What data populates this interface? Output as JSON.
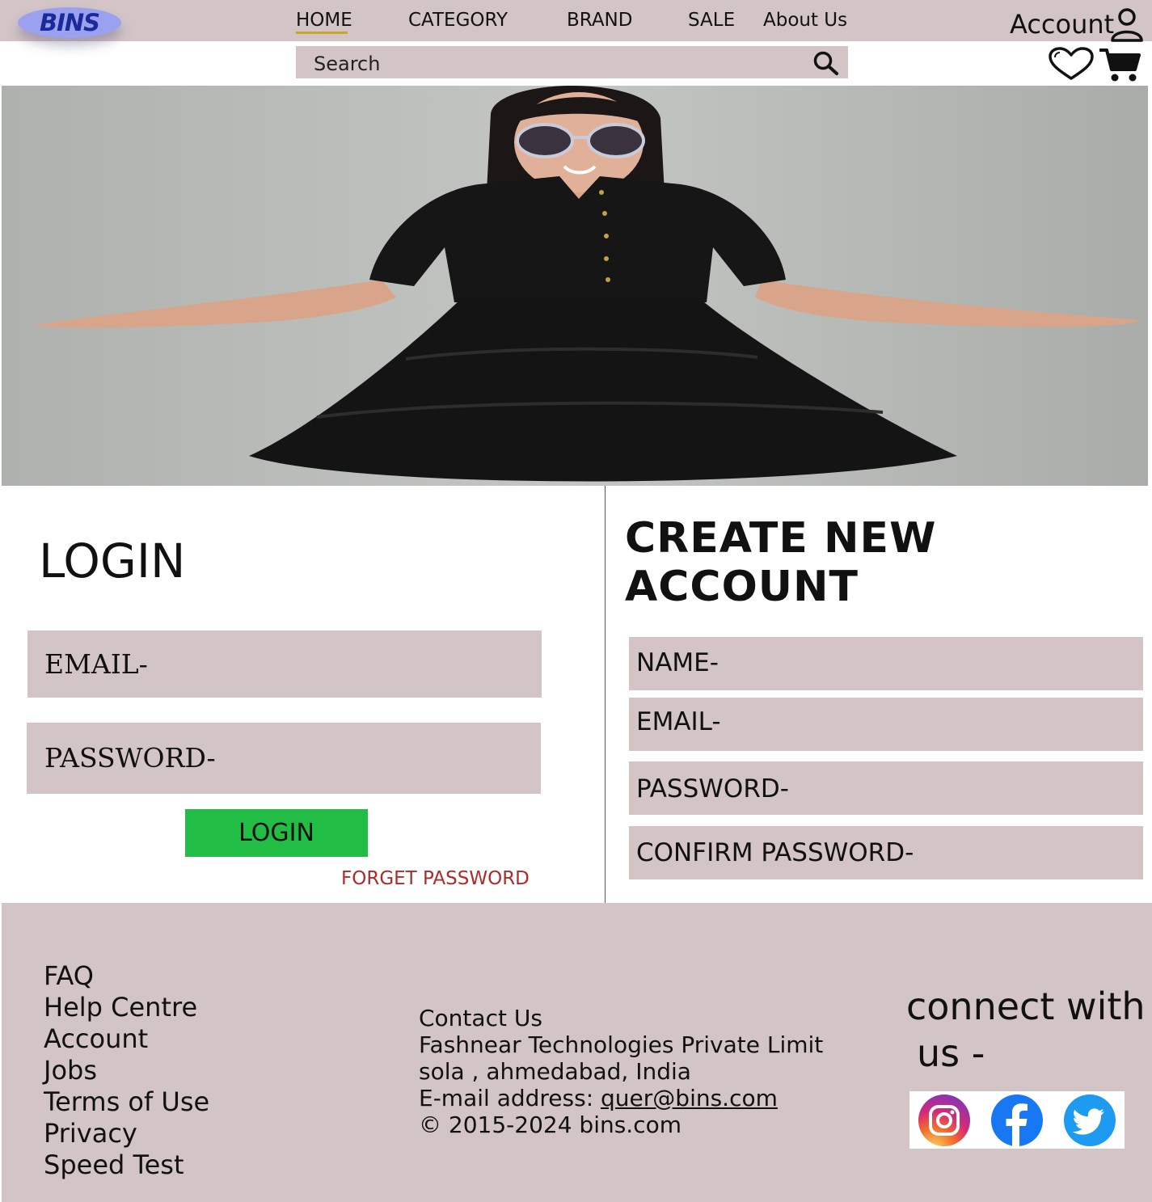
{
  "header": {
    "logo": "BINS",
    "nav": {
      "home": "HOME",
      "category": "CATEGORY",
      "brand": "BRAND",
      "sale": "SALE",
      "about": "About Us"
    },
    "account_label": "Account",
    "search_placeholder": "Search",
    "icons": [
      "user-icon",
      "search-icon",
      "heart-icon",
      "cart-icon"
    ]
  },
  "login": {
    "title": "LOGIN",
    "email_label": "EMAIL-",
    "password_label": "PASSWORD-",
    "button_label": "LOGIN",
    "forget_label": "FORGET PASSWORD"
  },
  "create": {
    "title": "CREATE NEW ACCOUNT",
    "name_label": "NAME-",
    "email_label": "EMAIL-",
    "password_label": "PASSWORD-",
    "confirm_label": "CONFIRM PASSWORD-"
  },
  "footer": {
    "links": [
      "FAQ",
      "Help Centre",
      "Account",
      "Jobs",
      "Terms of Use",
      "Privacy",
      "Speed Test"
    ],
    "contact": {
      "heading": "Contact Us",
      "company": "Fashnear Technologies Private Limit",
      "address": "sola , ahmedabad, India",
      "email_prefix": "E-mail address: ",
      "email": "quer@bins.com",
      "copyright": "© 2015-2024 bins.com"
    },
    "connect_line1": "connect with",
    "connect_line2": "us -",
    "social": [
      "instagram-icon",
      "facebook-icon",
      "twitter-icon"
    ]
  },
  "colors": {
    "panel": "#d3c5c6",
    "logo_bg": "#9aa2f0",
    "logo_text": "#1a2a9a",
    "login_button": "#21bd45",
    "forget_link": "#b02a2a",
    "nav_underline": "#c8a62a"
  }
}
